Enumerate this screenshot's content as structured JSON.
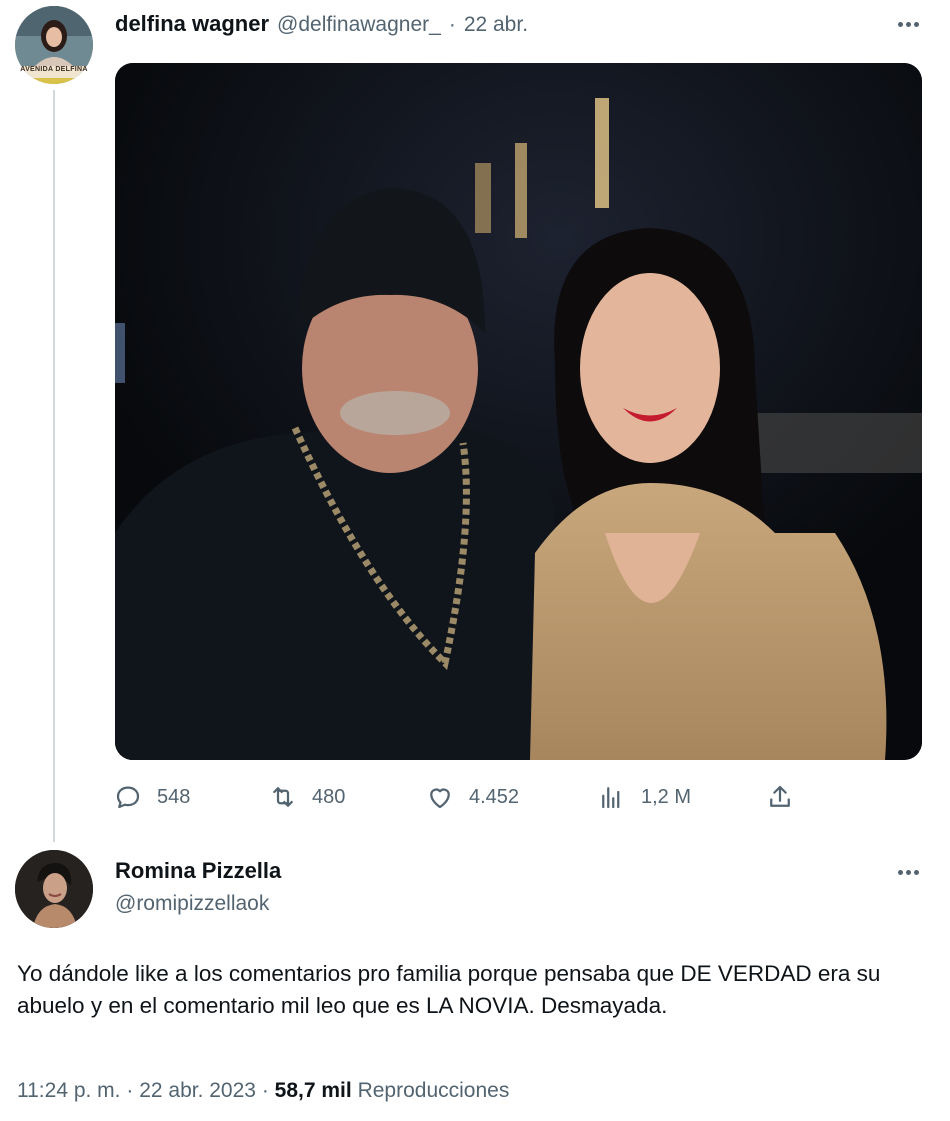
{
  "tweet": {
    "author_name": "delfina wagner",
    "author_handle": "@delfinawagner_",
    "separator": "·",
    "date": "22 abr.",
    "avatar_caption": "AVENIDA DELFINA",
    "stats": {
      "replies": "548",
      "retweets": "480",
      "likes": "4.452",
      "views": "1,2 M"
    }
  },
  "reply": {
    "author_name": "Romina Pizzella",
    "author_handle": "@romipizzellaok",
    "text": "Yo dándole like a los comentarios pro familia porque pensaba que DE VERDAD era su abuelo y en el comentario mil leo que es LA NOVIA. Desmayada.",
    "time": "11:24 p. m.",
    "separator": "·",
    "date": "22 abr. 2023",
    "views_count": "58,7 mil",
    "views_label": "Reproducciones"
  },
  "icons": {
    "more": "more-horizontal-icon",
    "reply": "speech-bubble-icon",
    "retweet": "retweet-arrows-icon",
    "like": "heart-icon",
    "views": "bar-chart-icon",
    "share": "share-upload-icon"
  },
  "colors": {
    "text_primary": "#0f1419",
    "text_secondary": "#536471",
    "thread_line": "#cfd9de"
  }
}
